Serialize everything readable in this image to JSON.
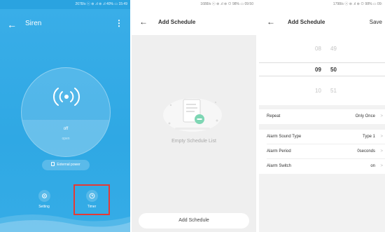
{
  "screen1": {
    "status": "2678/s ⓥ ⊜ .ıl ⊜ .ıl 40% ▭ 15:49",
    "title": "Siren",
    "state": "off",
    "substate": "open",
    "power_label": "External power",
    "setting_label": "Setting",
    "timer_label": "Timer"
  },
  "screen2": {
    "status": "1688/s ⓥ ⊜ .ıl ⊜ ⊙ 98% ▭ 09:50",
    "title": "Add Schedule",
    "empty_text": "Empty Schedule List",
    "add_button": "Add Schedule"
  },
  "screen3": {
    "status": "1798/s ⓥ ⊜ .ıl ⊜ ⊙ 98% ▭ 09:",
    "title": "Add Schedule",
    "save": "Save",
    "picker": [
      {
        "h": "08",
        "m": "49"
      },
      {
        "h": "09",
        "m": "50"
      },
      {
        "h": "10",
        "m": "51"
      }
    ],
    "settings": [
      {
        "label": "Repeat",
        "value": "Only Once"
      },
      {
        "label": "Alarm Sound Type",
        "value": "Type 1"
      },
      {
        "label": "Alarm Period",
        "value": "0seconds"
      },
      {
        "label": "Alarm Switch",
        "value": "on"
      }
    ]
  },
  "colors": {
    "siren_blue": "#2fa8e4",
    "highlight_red": "#e53935"
  }
}
